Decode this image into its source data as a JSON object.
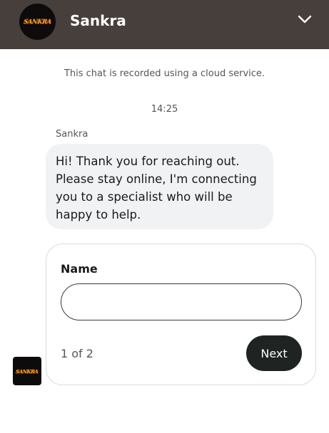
{
  "header": {
    "logo_text": "SANKRA",
    "agent_name": "Sankra",
    "collapse_icon": "chevron-down-icon",
    "background_color": "#473f3c"
  },
  "chat": {
    "notice": "This chat is recorded using a cloud service.",
    "timestamp": "14:25",
    "messages": [
      {
        "sender": "Sankra",
        "text": "Hi! Thank you for reaching out. Please stay online, I'm connecting you to a specialist who will be happy to help."
      }
    ]
  },
  "form": {
    "field_label": "Name",
    "field_value": "",
    "page_indicator": "1 of 2",
    "next_label": "Next",
    "button_color": "#1f2321"
  },
  "avatar": {
    "logo_text": "SANKRA"
  }
}
